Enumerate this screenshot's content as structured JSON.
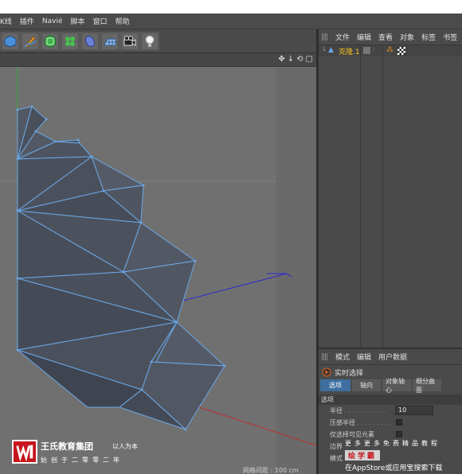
{
  "menubar": {
    "items": [
      "K线",
      "插件",
      "Navié",
      "脚本",
      "窗口",
      "帮助"
    ]
  },
  "toolbar": {
    "tools": [
      "cube-icon",
      "pen-icon",
      "subdivision-icon",
      "cloner-icon",
      "deformer-icon",
      "floor-icon",
      "camera-icon",
      "light-icon"
    ]
  },
  "viewport": {
    "nav_icons": [
      "move-icon",
      "down-arrow-icon",
      "rotate-icon",
      "maximize-icon"
    ],
    "grid_readout": "网格间距 : 100 cm"
  },
  "object_manager": {
    "menu": [
      "文件",
      "编辑",
      "查看",
      "对象",
      "标签",
      "书签"
    ],
    "object_name": "克隆.1"
  },
  "attribute_manager": {
    "menu": [
      "模式",
      "编辑",
      "用户数据"
    ],
    "tool_title": "实时选择",
    "tabs": [
      "选项",
      "轴向",
      "对象轴心",
      "细分曲面"
    ],
    "section": "选项",
    "properties": [
      {
        "label": "半径",
        "value": "10"
      },
      {
        "label": "压感半径",
        "value": ""
      },
      {
        "label": "仅选择可见元素",
        "value": ""
      },
      {
        "label": "边界",
        "value": ""
      },
      {
        "label": "模式",
        "value": ""
      }
    ]
  },
  "watermark": {
    "logo_title": "王氏教育集团",
    "logo_motto": "以人为本",
    "logo_sub": "始创于二零零二年",
    "promo_line1": "更多更多免费精品教程",
    "promo_brand": "绘学霸",
    "promo_line3": "在AppStore或应用宝搜索下载"
  },
  "colors": {
    "accent": "#3e6f9e",
    "mesh_fill": "#4c525d",
    "mesh_edge": "#6aa8e8",
    "brand_red": "#c7161d"
  }
}
